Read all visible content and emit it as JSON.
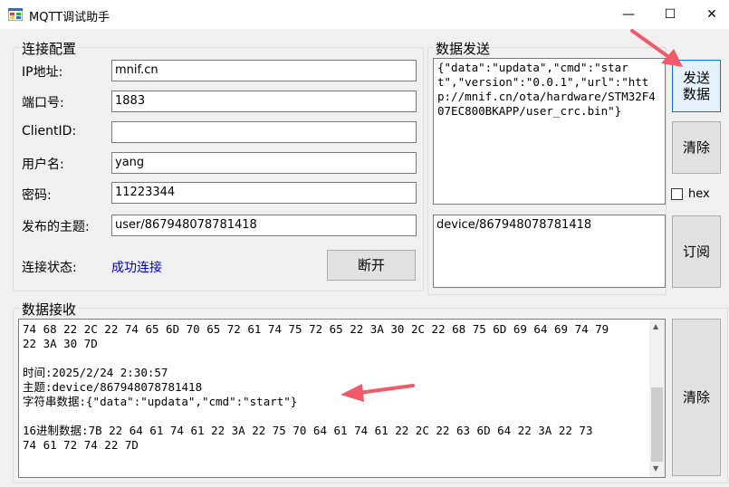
{
  "window": {
    "title": "MQTT调试助手"
  },
  "window_controls": {
    "minimize": "—",
    "maximize": "☐",
    "close": "✕"
  },
  "config": {
    "legend": "连接配置",
    "ip_label": "IP地址:",
    "ip_value": "mnif.cn",
    "port_label": "端口号:",
    "port_value": "1883",
    "clientid_label": "ClientID:",
    "clientid_value": "",
    "user_label": "用户名:",
    "user_value": "yang",
    "pass_label": "密码:",
    "pass_value": "11223344",
    "topic_label": "发布的主题:",
    "topic_value": "user/867948078781418",
    "status_label": "连接状态:",
    "status_value": "成功连接",
    "disconnect_button": "断开"
  },
  "send": {
    "legend": "数据发送",
    "payload": "{\"data\":\"updata\",\"cmd\":\"start\",\"version\":\"0.0.1\",\"url\":\"http://mnif.cn/ota/hardware/STM32F407EC800BKAPP/user_crc.bin\"}",
    "send_button": "发送\n数据",
    "clear_button": "清除",
    "hex_label": "hex",
    "subscribe_topic": "device/867948078781418",
    "subscribe_button": "订阅"
  },
  "receive": {
    "legend": "数据接收",
    "lines": [
      "74 68 22 2C 22 74 65 6D 70 65 72 61 74 75 72 65 22 3A 30 2C 22 68 75 6D 69 64 69 74 79",
      "22 3A 30 7D",
      "",
      "时间:2025/2/24 2:30:57",
      "主题:device/867948078781418",
      "字符串数据:{\"data\":\"updata\",\"cmd\":\"start\"}",
      "",
      "16进制数据:7B 22 64 61 74 61 22 3A 22 75 70 64 61 74 61 22 2C 22 63 6D 64 22 3A 22 73",
      "74 61 72 74 22 7D"
    ],
    "clear_button": "清除"
  },
  "colors": {
    "status_ok": "#0000cc",
    "arrow": "#f05a6a"
  }
}
